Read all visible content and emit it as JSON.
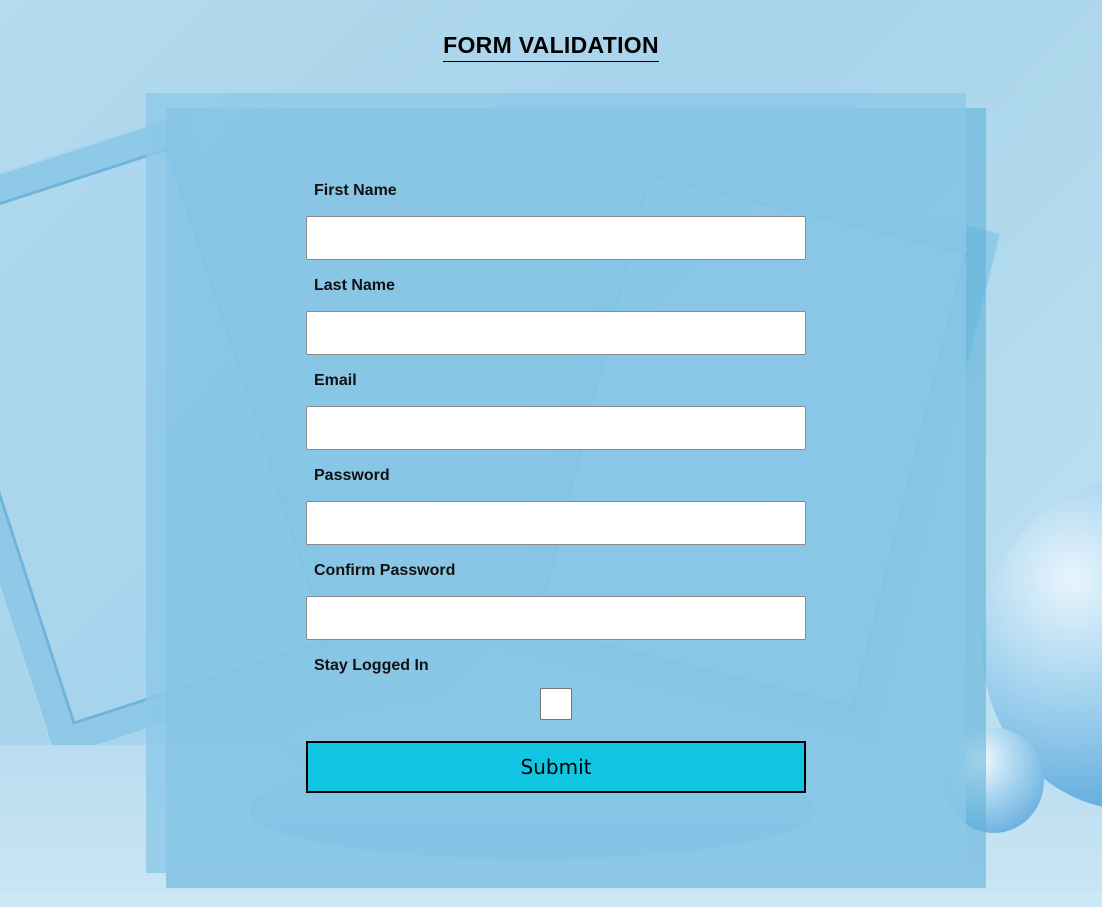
{
  "page": {
    "title": "FORM VALIDATION"
  },
  "form": {
    "fields": [
      {
        "label": "First Name",
        "value": "",
        "type": "text"
      },
      {
        "label": "Last Name",
        "value": "",
        "type": "text"
      },
      {
        "label": "Email",
        "value": "",
        "type": "email"
      },
      {
        "label": "Password",
        "value": "",
        "type": "password"
      },
      {
        "label": "Confirm Password",
        "value": "",
        "type": "password"
      }
    ],
    "stay_logged_in": {
      "label": "Stay Logged In",
      "checked": false
    },
    "submit_label": "Submit"
  },
  "colors": {
    "accent": "#10c6e3",
    "card": "#8cc8e8",
    "background": "#b5dbee"
  }
}
